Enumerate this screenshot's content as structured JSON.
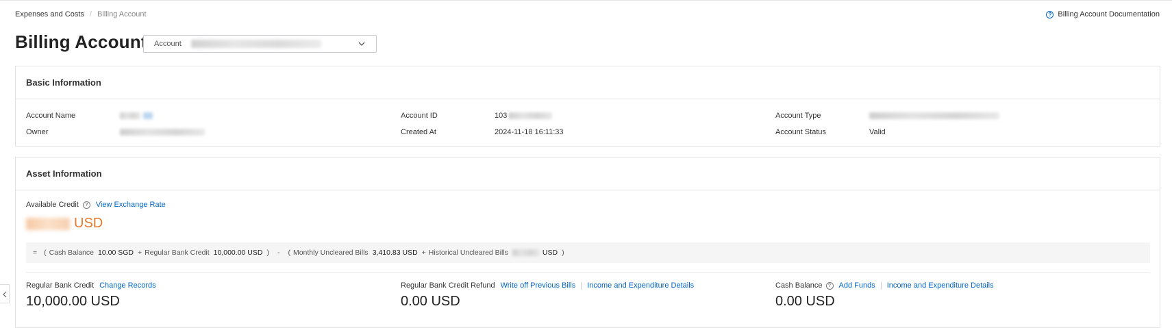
{
  "breadcrumb": {
    "parent": "Expenses and Costs",
    "separator": "/",
    "current": "Billing Account"
  },
  "doc_link": {
    "label": "Billing Account Documentation",
    "icon": "question-circle-icon"
  },
  "page": {
    "title": "Billing Account"
  },
  "account_select": {
    "label": "Account",
    "icon": "chevron-down-icon"
  },
  "basic_info": {
    "title": "Basic Information",
    "account_name_label": "Account Name",
    "owner_label": "Owner",
    "account_id_label": "Account ID",
    "account_id_value": "103",
    "created_at_label": "Created At",
    "created_at_value": "2024-11-18 16:11:33",
    "account_type_label": "Account Type",
    "account_status_label": "Account Status",
    "account_status_value": "Valid"
  },
  "asset_info": {
    "title": "Asset Information",
    "available_credit_label": "Available Credit",
    "view_exchange_rate": "View Exchange Rate",
    "available_credit_currency": "USD",
    "formula": {
      "eq": "=",
      "open1": "(",
      "cash_balance_label": "Cash Balance",
      "cash_balance_value": "10.00 SGD",
      "plus1": "+",
      "regular_bank_credit_label": "Regular Bank Credit",
      "regular_bank_credit_value": "10,000.00 USD",
      "close1": ")",
      "minus": "-",
      "open2": "(",
      "monthly_uncleared_label": "Monthly Uncleared Bills",
      "monthly_uncleared_value": "3,410.83 USD",
      "plus2": "+",
      "historical_uncleared_label": "Historical Uncleared Bills",
      "historical_uncleared_currency": "USD",
      "close2": ")"
    },
    "regular_bank_credit": {
      "label": "Regular Bank Credit",
      "link": "Change Records",
      "value": "10,000.00 USD"
    },
    "credit_refund": {
      "label": "Regular Bank Credit Refund",
      "link1": "Write off Previous Bills",
      "link2": "Income and Expenditure Details",
      "value": "0.00 USD"
    },
    "cash_balance": {
      "label": "Cash Balance",
      "link1": "Add Funds",
      "link2": "Income and Expenditure Details",
      "value": "0.00 USD"
    }
  },
  "colors": {
    "accent": "#0064c8",
    "credit": "#e8792b"
  }
}
